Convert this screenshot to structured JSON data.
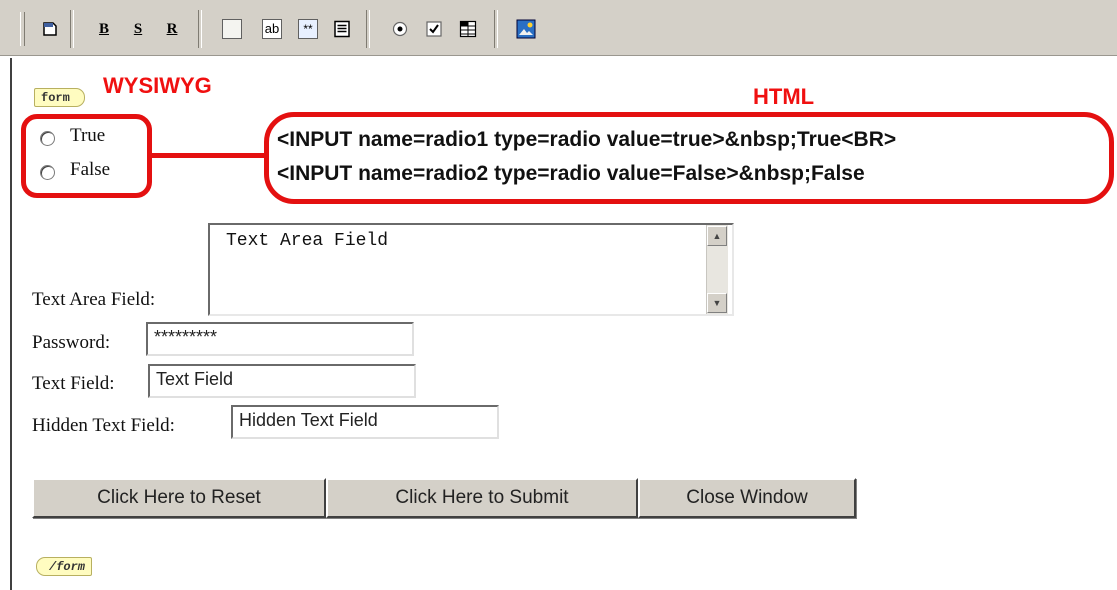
{
  "annotations": {
    "wysiwyg_label": "WYSIWYG",
    "html_label": "HTML",
    "html_code_lines": [
      "<INPUT name=radio1 type=radio value=true>&nbsp;True<BR>",
      "<INPUT name=radio2 type=radio value=False>&nbsp;False"
    ]
  },
  "toolbar": {
    "bold_label": "B",
    "s_label": "S",
    "r_label": "R",
    "textfield_label": "ab",
    "password_label": "**",
    "icons": [
      "page-icon",
      "bold-icon",
      "strike-icon",
      "reset-icon",
      "blank-box-icon",
      "textfield-icon",
      "password-field-icon",
      "textarea-icon",
      "radio-icon",
      "checkbox-icon",
      "list-icon",
      "image-icon"
    ]
  },
  "form": {
    "start_tag": "form",
    "end_tag": "/form",
    "radios": [
      {
        "label": "True"
      },
      {
        "label": "False"
      }
    ],
    "textarea_label": "Text Area Field:",
    "textarea_value": "Text Area Field",
    "password_label": "Password:",
    "password_value": "*********",
    "textfield_label": "Text Field:",
    "textfield_value": "Text Field",
    "hidden_label": "Hidden Text Field:",
    "hidden_value": "Hidden Text Field",
    "buttons": {
      "reset": "Click Here to Reset",
      "submit": "Click Here to Submit",
      "close": "Close Window"
    }
  },
  "colors": {
    "annotation_red": "#e41010",
    "toolbar_bg": "#d4d0c8",
    "tag_bg": "#fffcc0"
  }
}
